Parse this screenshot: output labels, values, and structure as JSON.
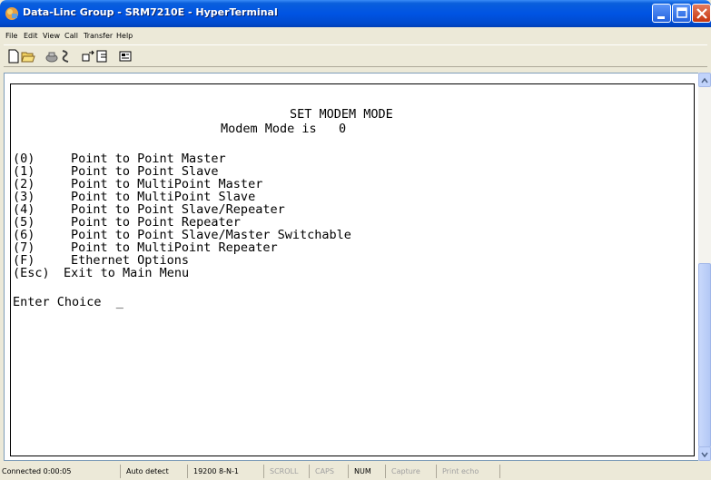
{
  "window": {
    "title": "Data-Linc Group - SRM7210E - HyperTerminal"
  },
  "menu": [
    "File",
    "Edit",
    "View",
    "Call",
    "Transfer",
    "Help"
  ],
  "toolbar": {
    "icons": [
      "new-icon",
      "open-icon",
      "connect-icon",
      "disconnect-icon",
      "send-icon",
      "receive-icon",
      "properties-icon"
    ]
  },
  "terminal": {
    "heading": "SET MODEM MODE",
    "mode_line": "Modem Mode is   0",
    "options": [
      {
        "key": "(0)",
        "label": "Point to Point Master"
      },
      {
        "key": "(1)",
        "label": "Point to Point Slave"
      },
      {
        "key": "(2)",
        "label": "Point to MultiPoint Master"
      },
      {
        "key": "(3)",
        "label": "Point to MultiPoint Slave"
      },
      {
        "key": "(4)",
        "label": "Point to Point Slave/Repeater"
      },
      {
        "key": "(5)",
        "label": "Point to Point Repeater"
      },
      {
        "key": "(6)",
        "label": "Point to Point Slave/Master Switchable"
      },
      {
        "key": "(7)",
        "label": "Point to MultiPoint Repeater"
      },
      {
        "key": "(F)",
        "label": "Ethernet Options"
      },
      {
        "key": "(Esc)",
        "label": "Exit to Main Menu"
      }
    ],
    "prompt": "Enter Choice  _"
  },
  "status": {
    "connected": "Connected 0:00:05",
    "detect": "Auto detect",
    "settings": "19200 8-N-1",
    "scroll": "SCROLL",
    "caps": "CAPS",
    "num": "NUM",
    "capture": "Capture",
    "print_echo": "Print echo"
  }
}
